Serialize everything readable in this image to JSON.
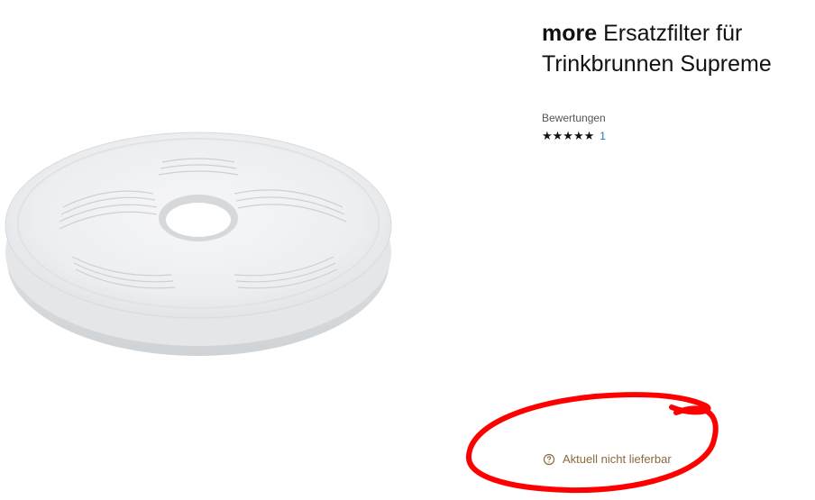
{
  "product": {
    "brand": "more",
    "title": "Ersatzfilter für Trinkbrunnen Supreme",
    "image_alt": "product-filter-image"
  },
  "ratings": {
    "label": "Bewertungen",
    "stars": "★★★★★",
    "stars_value": 5,
    "count": "1"
  },
  "availability": {
    "text": "Aktuell nicht lieferbar",
    "icon": "question-circle-icon"
  },
  "annotation": {
    "color": "#ff0000",
    "shape": "hand-drawn-ellipse"
  }
}
